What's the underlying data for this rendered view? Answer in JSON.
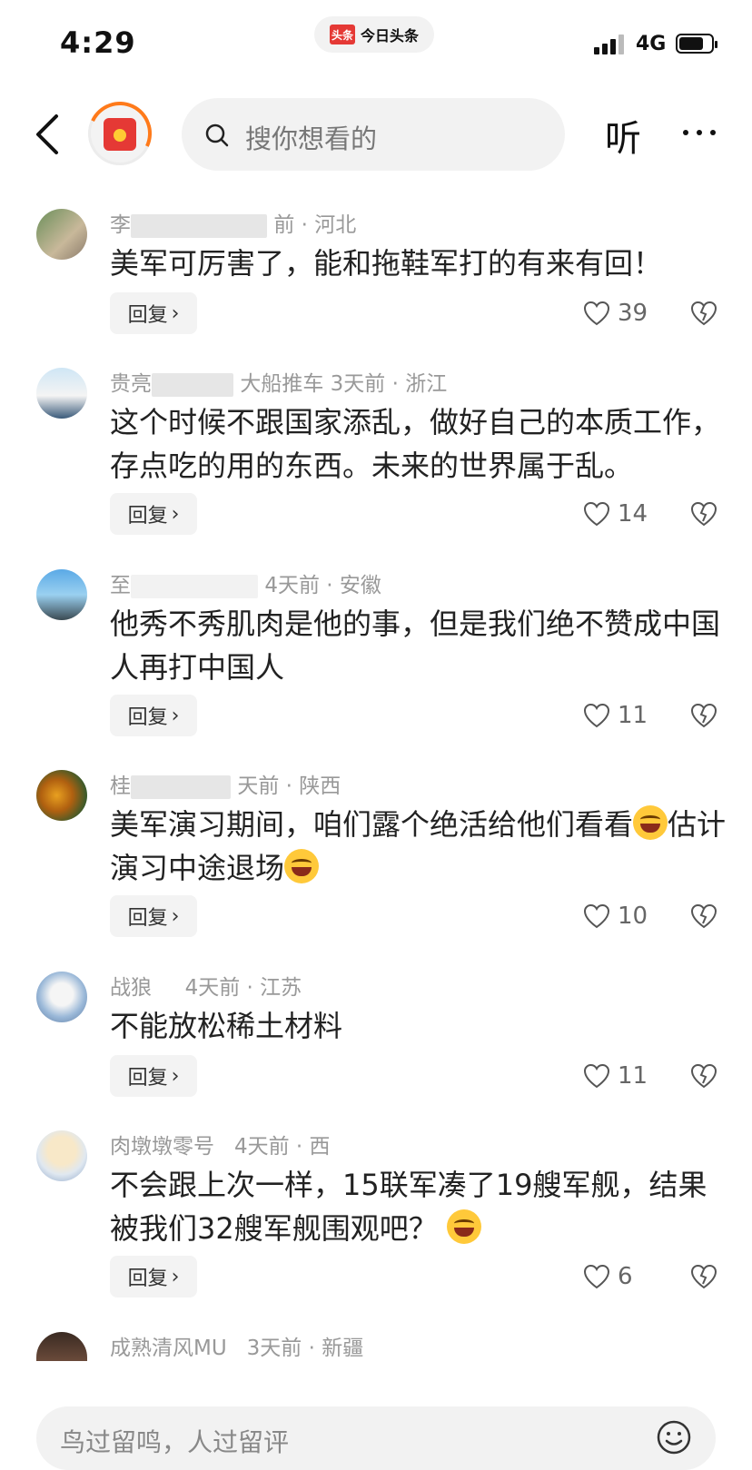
{
  "status_bar": {
    "time": "4:29",
    "app_logo_text": "头条",
    "app_name": "今日头条",
    "network": "4G",
    "battery_level": 0.75
  },
  "header": {
    "back_icon": "chevron-left-icon",
    "search_placeholder": "搜你想看的",
    "listen_label": "听",
    "more_icon": "ellipsis-icon"
  },
  "comments": [
    {
      "name_visible": "李",
      "meta_tail": "前 · 河北",
      "text": "美军可厉害了，能和拖鞋军打的有来有回！",
      "reply_label": "回复",
      "likes": "39"
    },
    {
      "name_visible": "贵亮",
      "meta_tail": "大船推车  3天前 · 浙江",
      "text": "这个时候不跟国家添乱，做好自己的本质工作，存点吃的用的东西。未来的世界属于乱。",
      "reply_label": "回复",
      "likes": "14"
    },
    {
      "name_visible": "至",
      "meta_tail": "4天前 · 安徽",
      "text": "他秀不秀肌肉是他的事，但是我们绝不赞成中国人再打中国人",
      "reply_label": "回复",
      "likes": "11"
    },
    {
      "name_visible": "桂",
      "meta_tail": "天前 · 陕西",
      "text_a": "美军演习期间，咱们露个绝活给他们看看",
      "text_b": "估计演习中途退场",
      "reply_label": "回复",
      "likes": "10"
    },
    {
      "name_visible": "战狼",
      "meta_tail": "4天前 · 江苏",
      "text": "不能放松稀土材料",
      "reply_label": "回复",
      "likes": "11"
    },
    {
      "name_visible": "肉墩墩零号",
      "meta_tail": "4天前 · 西",
      "text": "不会跟上次一样，15联军凑了19艘军舰，结果被我们32艘军舰围观吧？",
      "reply_label": "回复",
      "likes": "6"
    },
    {
      "name_visible": "成熟清风MU",
      "meta_tail": "3天前 · 新疆"
    }
  ],
  "input_bar": {
    "placeholder": "鸟过留鸣，人过留评",
    "emoji_icon": "smiley-icon"
  }
}
